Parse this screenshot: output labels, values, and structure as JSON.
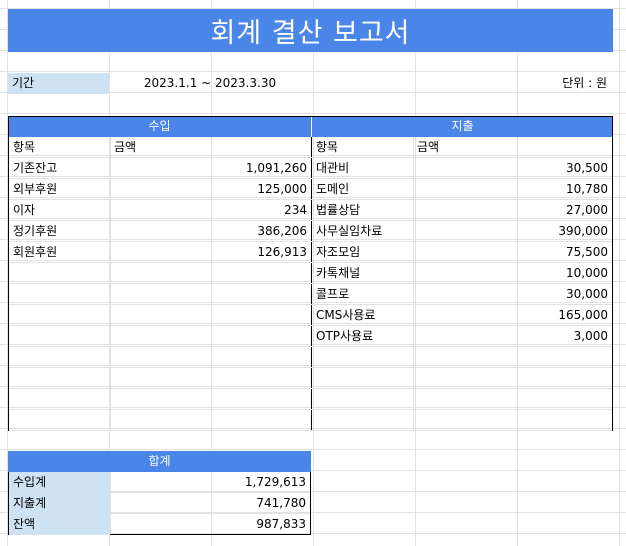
{
  "title": "회계 결산 보고서",
  "period": {
    "label": "기간",
    "value": "2023.1.1 ~ 2023.3.30"
  },
  "unit": "단위 : 원",
  "income": {
    "header": "수입",
    "col_item": "항목",
    "col_amount": "금액",
    "rows": [
      {
        "item": "기존잔고",
        "amount": "1,091,260"
      },
      {
        "item": "외부후원",
        "amount": "125,000"
      },
      {
        "item": "이자",
        "amount": "234"
      },
      {
        "item": "정기후원",
        "amount": "386,206"
      },
      {
        "item": "회원후원",
        "amount": "126,913"
      }
    ]
  },
  "expense": {
    "header": "지출",
    "col_item": "항목",
    "col_amount": "금액",
    "rows": [
      {
        "item": "대관비",
        "amount": "30,500"
      },
      {
        "item": "도메인",
        "amount": "10,780"
      },
      {
        "item": "법률상담",
        "amount": "27,000"
      },
      {
        "item": "사무실임차료",
        "amount": "390,000"
      },
      {
        "item": "자조모임",
        "amount": "75,500"
      },
      {
        "item": "카톡채널",
        "amount": "10,000"
      },
      {
        "item": "콜프로",
        "amount": "30,000"
      },
      {
        "item": "CMS사용료",
        "amount": "165,000"
      },
      {
        "item": "OTP사용료",
        "amount": "3,000"
      }
    ]
  },
  "summary": {
    "header": "합계",
    "rows": [
      {
        "label": "수입계",
        "amount": "1,729,613"
      },
      {
        "label": "지출계",
        "amount": "741,780"
      },
      {
        "label": "잔액",
        "amount": "987,833"
      }
    ]
  },
  "colors": {
    "accent": "#4a86e8",
    "label_fill": "#cfe2f3"
  }
}
